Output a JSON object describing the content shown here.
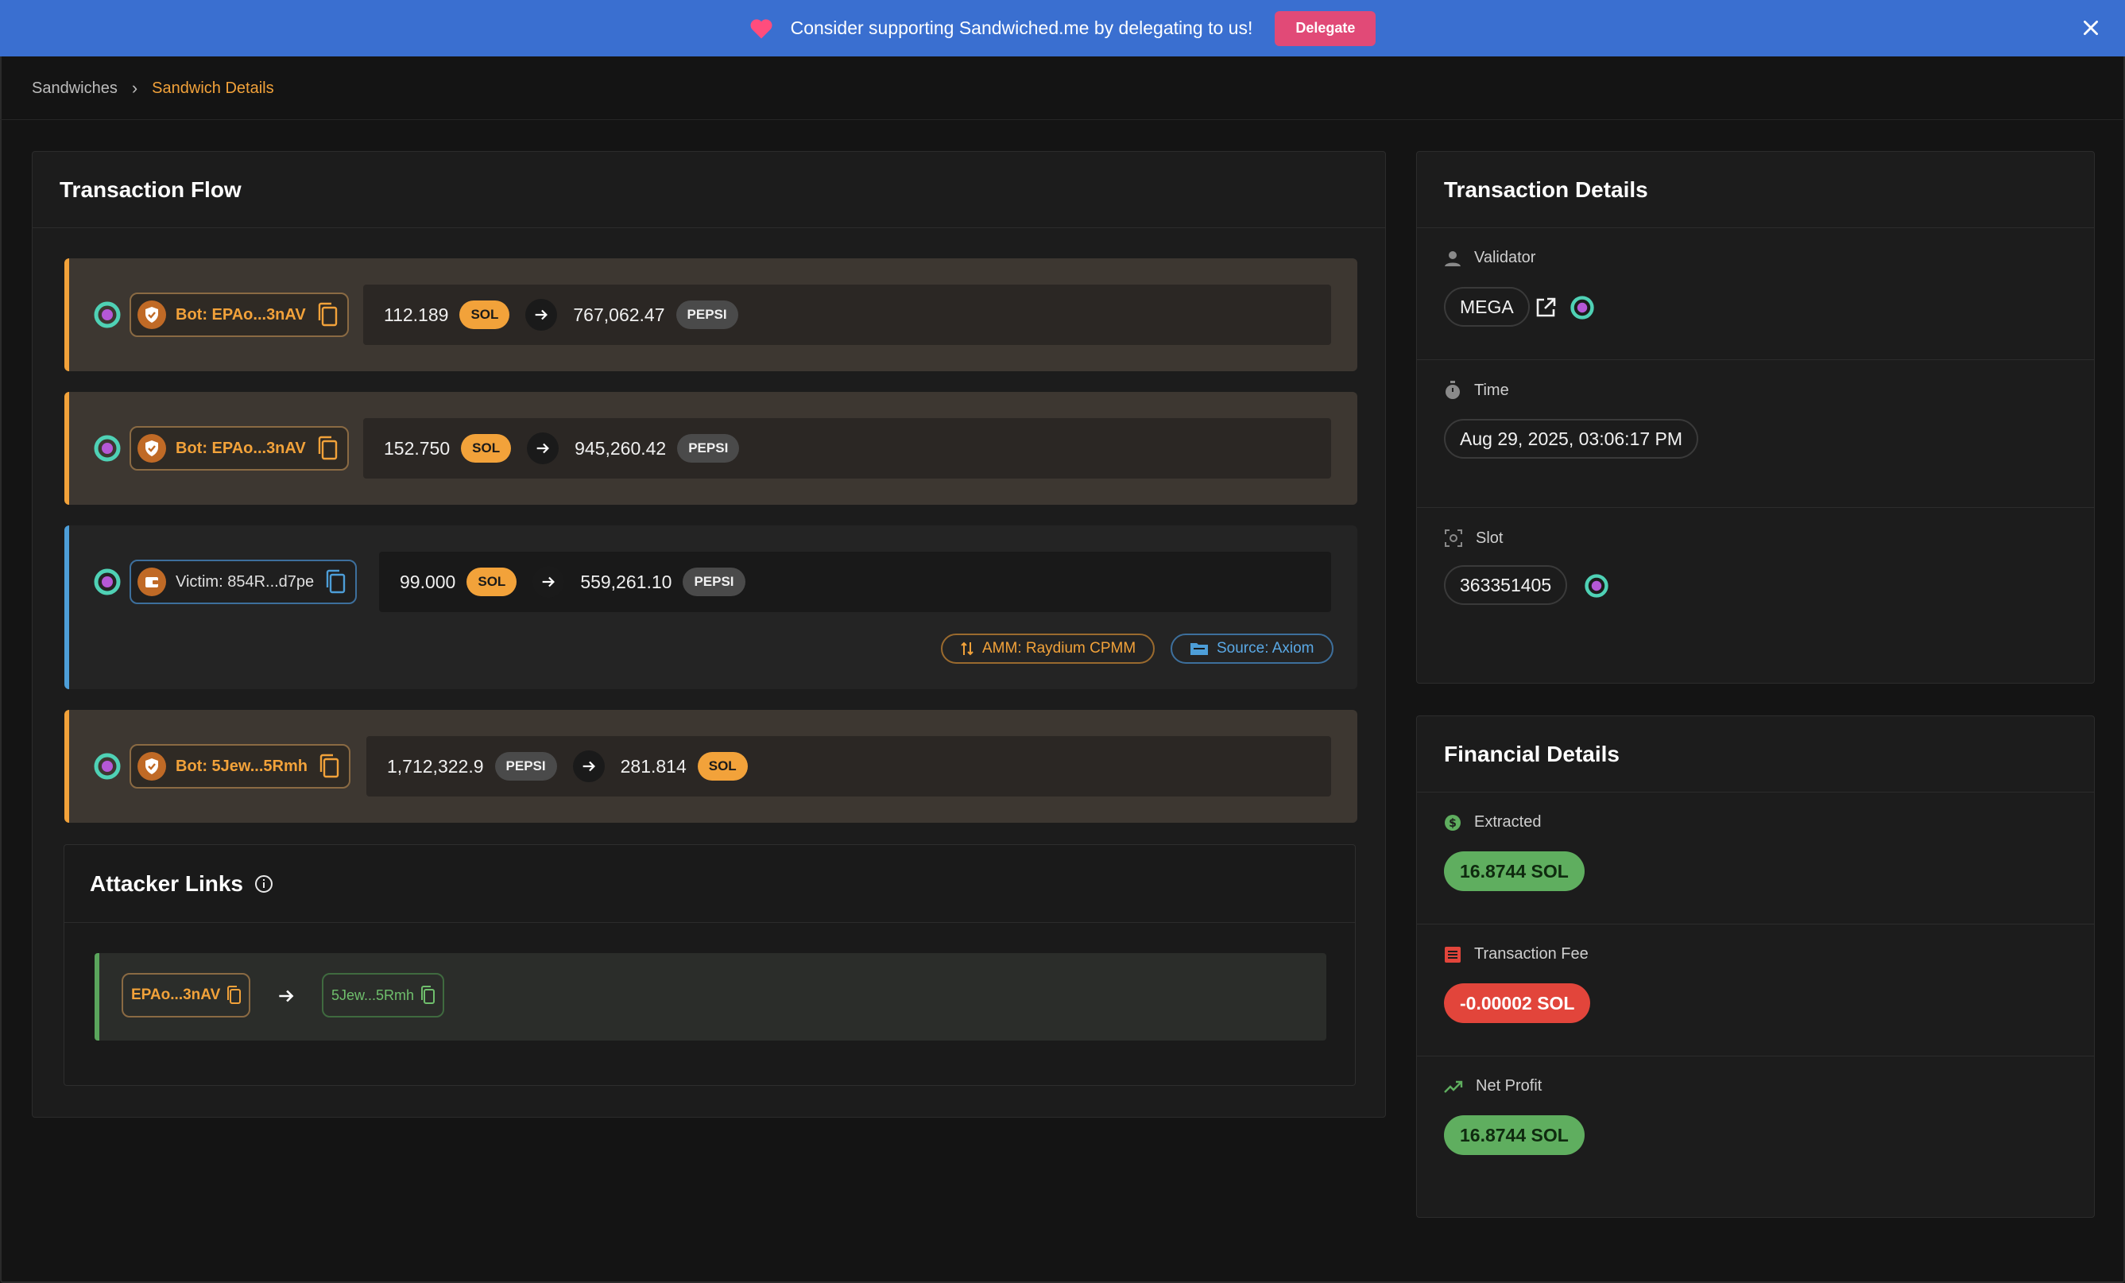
{
  "banner": {
    "message": "Consider supporting Sandwiched.me by delegating to us!",
    "delegate_label": "Delegate"
  },
  "breadcrumb": {
    "items": [
      "Sandwiches",
      "Sandwich Details"
    ],
    "separator": "›"
  },
  "transaction_flow": {
    "title": "Transaction Flow",
    "rows": [
      {
        "role": "bot",
        "label": "Bot: EPAo...3nAV",
        "in_amount": "112.189",
        "in_token": "SOL",
        "out_amount": "767,062.47",
        "out_token": "PEPSI"
      },
      {
        "role": "bot",
        "label": "Bot: EPAo...3nAV",
        "in_amount": "152.750",
        "in_token": "SOL",
        "out_amount": "945,260.42",
        "out_token": "PEPSI"
      },
      {
        "role": "victim",
        "label": "Victim: 854R...d7pe",
        "in_amount": "99.000",
        "in_token": "SOL",
        "out_amount": "559,261.10",
        "out_token": "PEPSI",
        "amm_tag": "AMM: Raydium CPMM",
        "source_tag": "Source: Axiom"
      },
      {
        "role": "bot",
        "label": "Bot: 5Jew...5Rmh",
        "in_amount": "1,712,322.9",
        "in_token": "PEPSI",
        "out_amount": "281.814",
        "out_token": "SOL"
      }
    ]
  },
  "attacker_links": {
    "title": "Attacker Links",
    "from": "EPAo...3nAV",
    "to": "5Jew...5Rmh"
  },
  "transaction_details": {
    "title": "Transaction Details",
    "validator_label": "Validator",
    "validator_value": "MEGA",
    "time_label": "Time",
    "time_value": "Aug 29, 2025, 03:06:17 PM",
    "slot_label": "Slot",
    "slot_value": "363351405"
  },
  "financial_details": {
    "title": "Financial Details",
    "extracted_label": "Extracted",
    "extracted_value": "16.8744 SOL",
    "fee_label": "Transaction Fee",
    "fee_value": "-0.00002 SOL",
    "profit_label": "Net Profit",
    "profit_value": "16.8744 SOL"
  },
  "colors": {
    "banner": "#3a6fd0",
    "accent_orange": "#f2a23a",
    "victim_blue": "#4d9ed8",
    "green": "#5fae5f",
    "red": "#e2453b"
  }
}
